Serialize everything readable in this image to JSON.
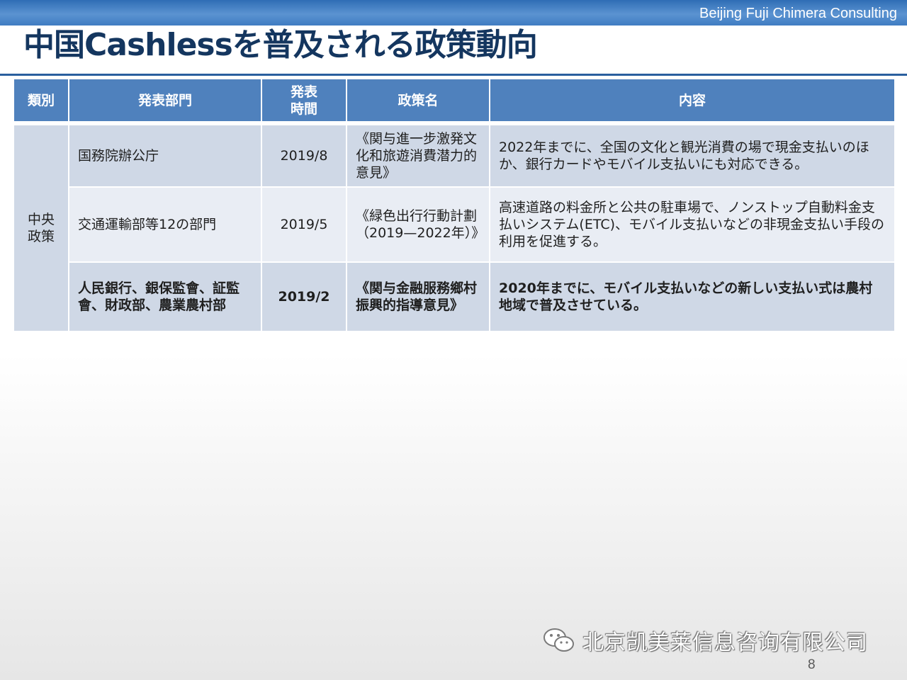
{
  "header": {
    "company": "Beijing Fuji Chimera Consulting",
    "title": "中国Cashlessを普及される政策動向"
  },
  "table": {
    "headers": {
      "category": "類別",
      "department": "発表部門",
      "time_line1": "発表",
      "time_line2": "時間",
      "policy": "政策名",
      "content": "内容"
    },
    "category_line1": "中央",
    "category_line2": "政策",
    "rows": [
      {
        "department": "国務院辦公庁",
        "date": "2019/8",
        "policy": "《関与進一步激発文化和旅遊消費潜力的意見》",
        "content": "2022年までに、全国の文化と観光消費の場で現金支払いのほか、銀行カードやモバイル支払いにも対応できる。"
      },
      {
        "department": "交通運輸部等12の部門",
        "date": "2019/5",
        "policy": "《緑色出行行動計劃（2019—2022年）》",
        "content": "高速道路の料金所と公共の駐車場で、ノンストップ自動料金支払いシステム(ETC)、モバイル支払いなどの非現金支払い手段の利用を促進する。"
      },
      {
        "department": "人民銀行、銀保監會、証監會、財政部、農業農村部",
        "date": "2019/2",
        "policy": "《関与金融服務鄉村振興的指導意見》",
        "content": "2020年までに、モバイル支払いなどの新しい支払い式は農村地域で普及させている。"
      }
    ]
  },
  "watermark": {
    "text": "北京凯美莱信息咨询有限公司",
    "icon": "wechat-icon"
  },
  "page_number": "8"
}
